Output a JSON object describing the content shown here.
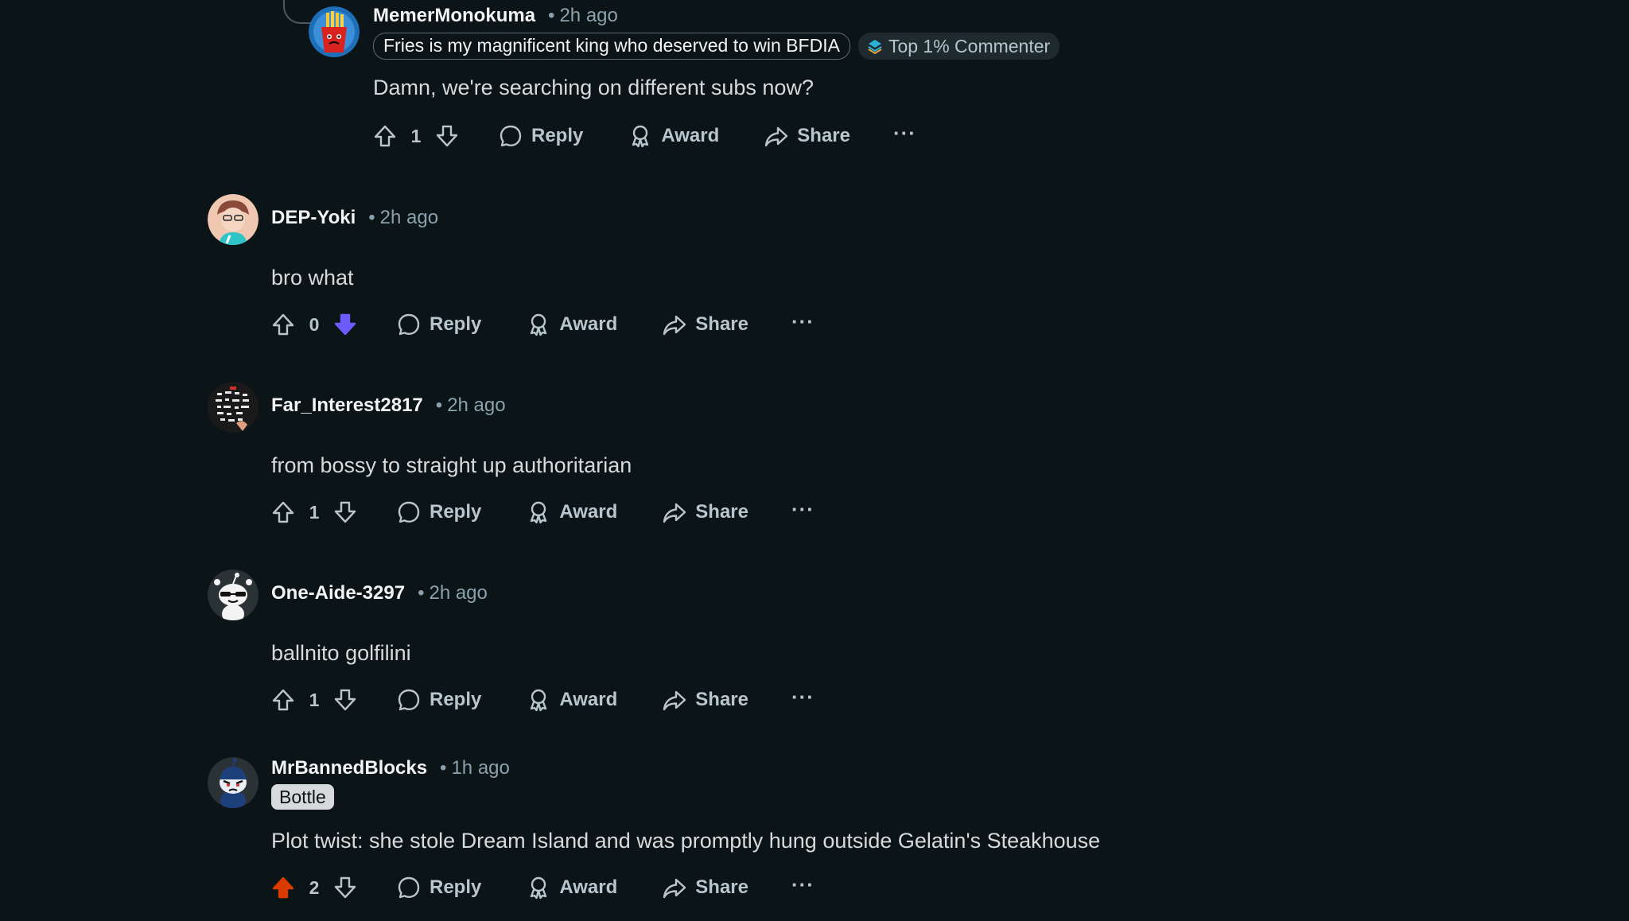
{
  "comments": [
    {
      "username": "MemerMonokuma",
      "time": "2h ago",
      "flair": "Fries is my magnificent king who deserved to win BFDIA",
      "badge": "Top 1% Commenter",
      "body": "Damn, we're searching on different subs now?",
      "score": "1",
      "vote": "none"
    },
    {
      "username": "DEP-Yoki",
      "time": "2h ago",
      "body": "bro what",
      "score": "0",
      "vote": "down"
    },
    {
      "username": "Far_Interest2817",
      "time": "2h ago",
      "body": "from bossy to straight up authoritarian",
      "score": "1",
      "vote": "none"
    },
    {
      "username": "One-Aide-3297",
      "time": "2h ago",
      "body": "ballnito golfilini",
      "score": "1",
      "vote": "none"
    },
    {
      "username": "MrBannedBlocks",
      "time": "1h ago",
      "flair": "Bottle",
      "body": "Plot twist: she stole Dream Island and was promptly hung outside Gelatin's Steakhouse",
      "score": "2",
      "vote": "up"
    }
  ],
  "actions": {
    "reply": "Reply",
    "award": "Award",
    "share": "Share",
    "more": "···"
  },
  "separator": "•",
  "colors": {
    "background": "#0b1416",
    "upvote_active": "#d93a00",
    "downvote_active": "#6a5cff",
    "text_muted": "#8ba2ad"
  },
  "icons": [
    "upvote-icon",
    "downvote-icon",
    "reply-icon",
    "award-icon",
    "share-icon",
    "more-icon",
    "top-commenter-icon"
  ]
}
